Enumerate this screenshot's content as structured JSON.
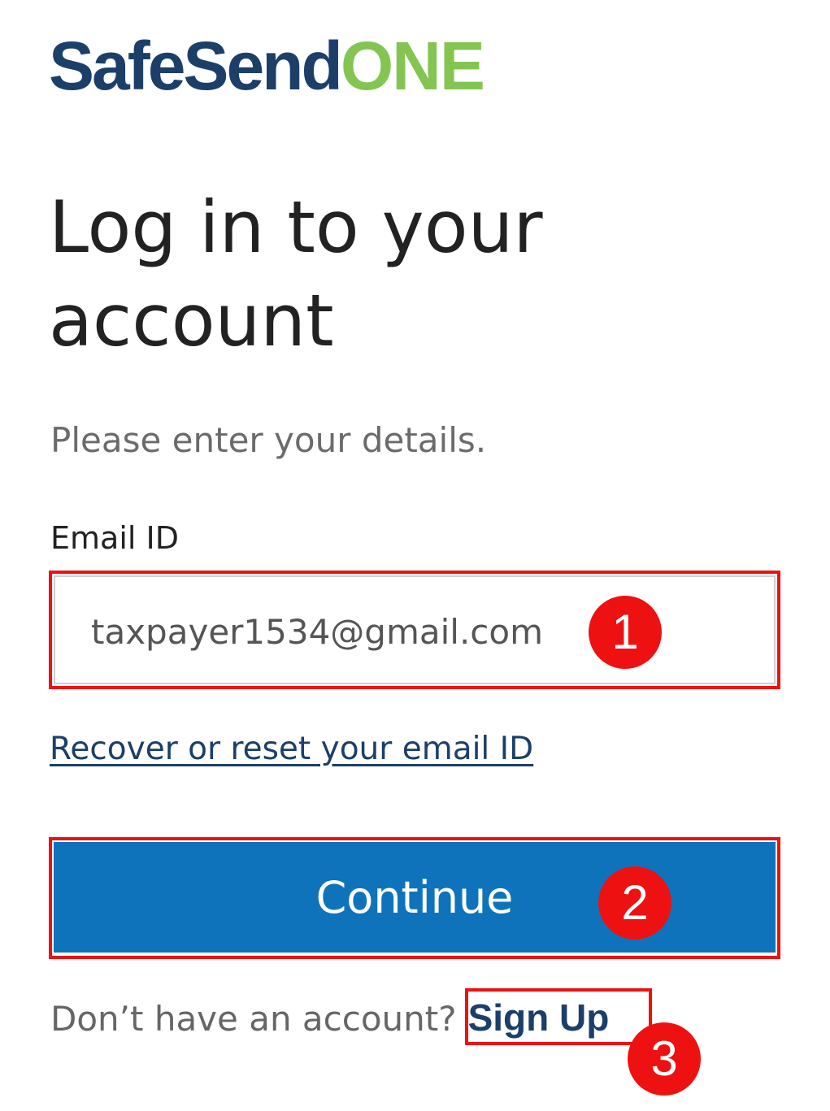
{
  "logo": {
    "brand": "SafeSend",
    "suffix": "ONE",
    "colors": {
      "brand": "#1b3f69",
      "suffix": "#84c552"
    }
  },
  "heading": "Log in to your account",
  "subtitle": "Please enter your details.",
  "email": {
    "label": "Email ID",
    "value": "taxpayer1534@gmail.com"
  },
  "recover_link": "Recover or reset your email ID",
  "continue_label": "Continue",
  "signup": {
    "prompt": "Don’t have an account?",
    "link": "Sign Up"
  },
  "annotations": {
    "marker_1": "1",
    "marker_2": "2",
    "marker_3": "3",
    "color": "#ee1111"
  },
  "colors": {
    "button": "#0f73bb",
    "link": "#1b3f69"
  }
}
